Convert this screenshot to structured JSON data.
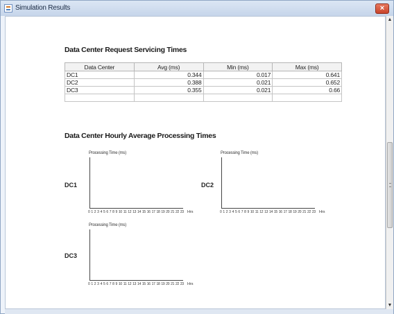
{
  "window": {
    "title": "Simulation Results",
    "close_glyph": "×",
    "icon": "app-document-icon"
  },
  "scrollbar": {
    "up_glyph": "▲",
    "down_glyph": "▼"
  },
  "request_section": {
    "heading": "Data Center Request Servicing Times",
    "columns": [
      "Data Center",
      "Avg (ms)",
      "Min (ms)",
      "Max (ms)"
    ],
    "rows": [
      {
        "name": "DC1",
        "avg": "0.344",
        "min": "0.017",
        "max": "0.641"
      },
      {
        "name": "DC2",
        "avg": "0.388",
        "min": "0.021",
        "max": "0.652"
      },
      {
        "name": "DC3",
        "avg": "0.355",
        "min": "0.021",
        "max": "0.66"
      }
    ]
  },
  "processing_section": {
    "heading": "Data Center Hourly Average Processing Times",
    "y_caption": "Processing Time (ms)",
    "x_unit": "Hrs",
    "hours": [
      "0",
      "1",
      "2",
      "3",
      "4",
      "5",
      "6",
      "7",
      "8",
      "9",
      "10",
      "11",
      "12",
      "13",
      "14",
      "15",
      "16",
      "17",
      "18",
      "19",
      "20",
      "21",
      "22",
      "23"
    ],
    "charts": [
      {
        "label": "DC1"
      },
      {
        "label": "DC2"
      },
      {
        "label": "DC3"
      }
    ]
  }
}
